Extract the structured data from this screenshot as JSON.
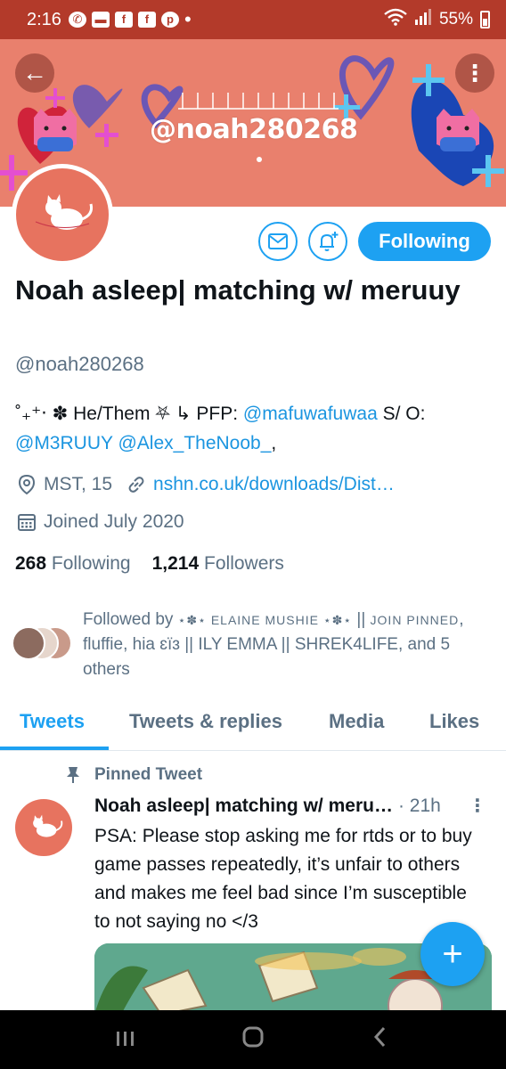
{
  "status_bar": {
    "time": "2:16",
    "battery": "55%",
    "notification_icons": [
      "whatsapp-icon",
      "chat-icon",
      "facebook-icon",
      "facebook-icon",
      "pinterest-icon",
      "dot-icon"
    ]
  },
  "banner": {
    "handle_text": "@noah280268",
    "background_color": "#e9806d"
  },
  "actions": {
    "following_label": "Following"
  },
  "profile": {
    "display_name": "Noah asleep| matching w/ meruuy",
    "handle": "@noah280268",
    "bio_prefix": "˚₊⁺‧ ✽ He/Them ⛧ ↳ PFP: ",
    "bio_link1": "@mafuwafuwaa",
    "bio_mid": " S/ O: ",
    "bio_link2": "@M3RUUY",
    "bio_link3": "@Alex_TheNoob_",
    "bio_suffix": ",",
    "location": "MST, 15",
    "website": "nshn.co.uk/downloads/Dist…",
    "joined": "Joined July 2020",
    "following_count": "268",
    "following_label": "Following",
    "followers_count": "1,214",
    "followers_label": "Followers"
  },
  "followed_by": {
    "prefix": "Followed by ",
    "name1": "⋆✽⋆ ELAINE MUSHIE ⋆✽⋆",
    "sep1": " || ",
    "name2": "JOIN PINNED",
    "rest": ", fluffie, hia ɛïɜ || ILY EMMA || SHREK4LIFE, and 5 others"
  },
  "tabs": [
    {
      "label": "Tweets",
      "active": true
    },
    {
      "label": "Tweets & replies",
      "active": false
    },
    {
      "label": "Media",
      "active": false
    },
    {
      "label": "Likes",
      "active": false
    }
  ],
  "pinned_tweet": {
    "pinned_label": "Pinned Tweet",
    "author": "Noah asleep| matching w/ meru…",
    "time": "· 21h",
    "text": "PSA: Please stop asking me for rtds or to buy game passes repeatedly, it’s unfair to others and makes me feel bad since I’m susceptible to not saying no </3"
  },
  "colors": {
    "accent": "#1da1f2",
    "status_bar": "#b33a2a",
    "secondary_text": "#5b7083"
  }
}
